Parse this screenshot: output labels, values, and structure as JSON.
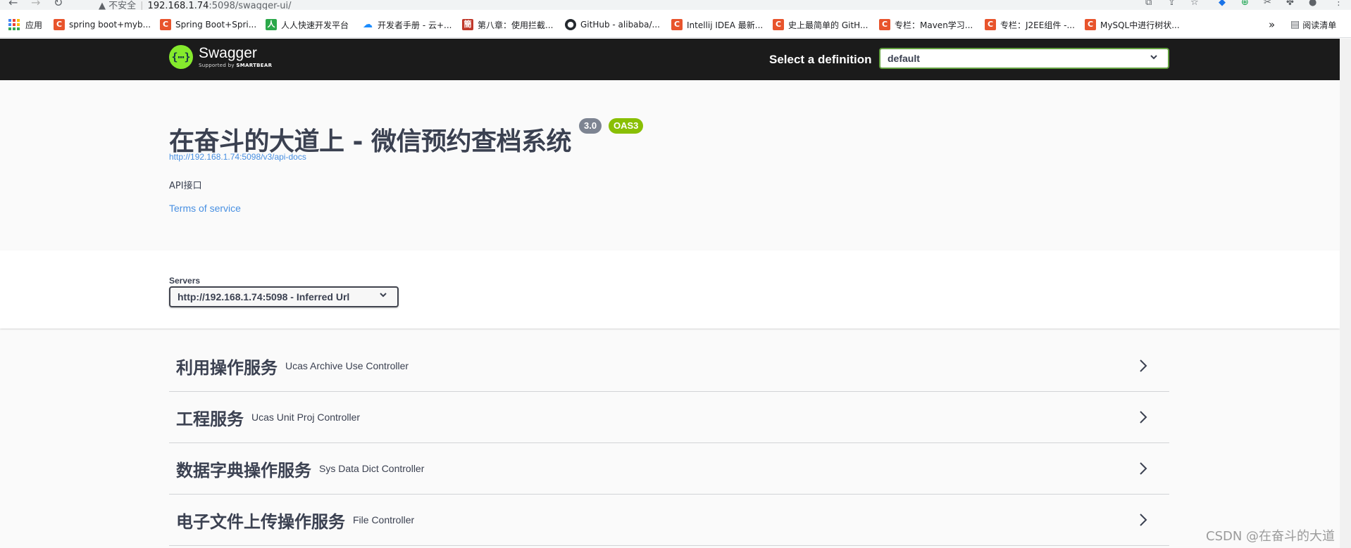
{
  "browser": {
    "url_warning": "不安全",
    "url_host": "192.168.1.74",
    "url_rest": ":5098/swagger-ui/",
    "bookmarks": [
      {
        "label": "应用",
        "icon": "apps-grid-icon"
      },
      {
        "label": "spring boot+myb...",
        "icon": "csdn-icon"
      },
      {
        "label": "Spring Boot+Spri...",
        "icon": "csdn-icon"
      },
      {
        "label": "人人快速开发平台",
        "icon": "renren-icon"
      },
      {
        "label": "开发者手册 - 云+...",
        "icon": "cloud-icon"
      },
      {
        "label": "第八章：使用拦截...",
        "icon": "jianshu-icon"
      },
      {
        "label": "GitHub - alibaba/...",
        "icon": "github-icon"
      },
      {
        "label": "Intellij IDEA 最新...",
        "icon": "csdn-icon"
      },
      {
        "label": "史上最简单的 GitH...",
        "icon": "csdn-icon"
      },
      {
        "label": "专栏：Maven学习...",
        "icon": "csdn-icon"
      },
      {
        "label": "专栏：J2EE组件 -...",
        "icon": "csdn-icon"
      },
      {
        "label": "MySQL中进行树状...",
        "icon": "csdn-icon"
      }
    ],
    "more_bookmarks": "»",
    "reading_list": "阅读清单"
  },
  "topbar": {
    "logo_name": "Swagger",
    "logo_sub_prefix": "Supported by",
    "logo_sub_brand": "SMARTBEAR",
    "definition_label": "Select a definition",
    "definition_value": "default"
  },
  "info": {
    "title": "在奋斗的大道上 - 微信预约查档系统",
    "version_badge": "3.0",
    "oas_badge": "OAS3",
    "api_docs_url": "http://192.168.1.74:5098/v3/api-docs",
    "description": "API接口",
    "terms_link": "Terms of service"
  },
  "servers": {
    "label": "Servers",
    "selected": "http://192.168.1.74:5098 - Inferred Url"
  },
  "tags": [
    {
      "name": "利用操作服务",
      "description": "Ucas Archive Use Controller"
    },
    {
      "name": "工程服务",
      "description": "Ucas Unit Proj Controller"
    },
    {
      "name": "数据字典操作服务",
      "description": "Sys Data Dict Controller"
    },
    {
      "name": "电子文件上传操作服务",
      "description": "File Controller"
    }
  ],
  "watermark": "CSDN @在奋斗的大道",
  "colors": {
    "topbar_bg": "#1b1b1b",
    "swagger_green": "#85ea2d",
    "select_border": "#62a03f",
    "oas_badge": "#89bf04",
    "version_badge": "#7d8492",
    "link": "#4990e2"
  }
}
